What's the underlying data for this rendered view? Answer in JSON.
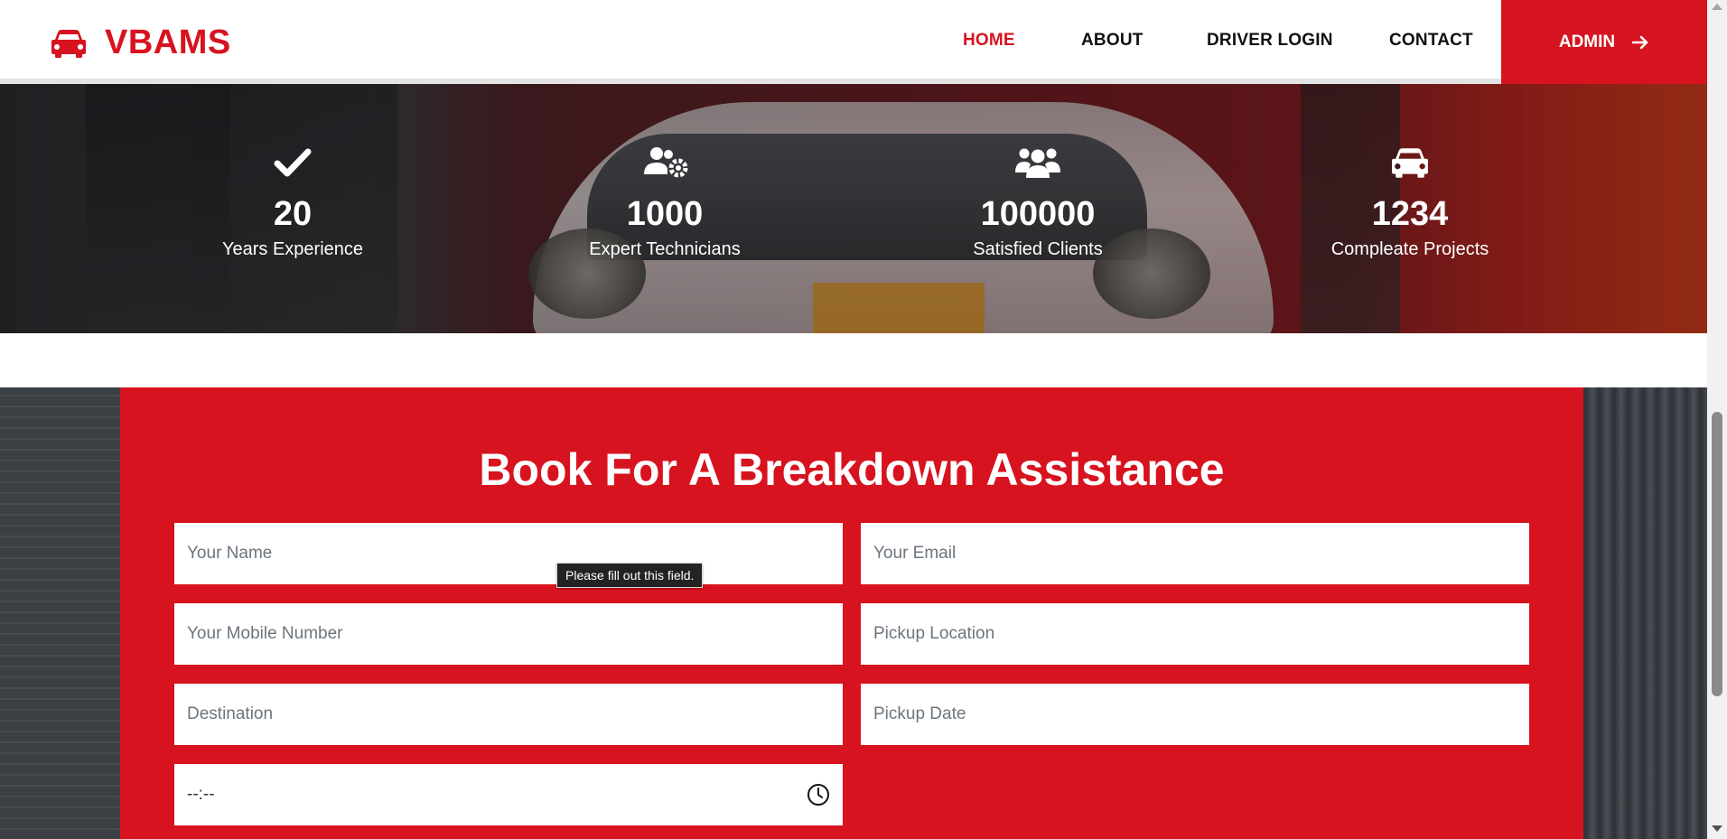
{
  "brand": {
    "name": "VBAMS",
    "icon": "car-icon",
    "color": "#d7131f"
  },
  "nav": {
    "items": [
      {
        "label": "HOME",
        "active": true
      },
      {
        "label": "ABOUT",
        "active": false
      },
      {
        "label": "DRIVER LOGIN",
        "active": false
      },
      {
        "label": "CONTACT",
        "active": false
      }
    ],
    "admin_label": "ADMIN",
    "admin_icon": "arrow-right-icon"
  },
  "stats": [
    {
      "icon": "check-icon",
      "number": "20",
      "label": "Years Experience"
    },
    {
      "icon": "users-gear-icon",
      "number": "1000",
      "label": "Expert Technicians"
    },
    {
      "icon": "users-icon",
      "number": "100000",
      "label": "Satisfied Clients"
    },
    {
      "icon": "car-icon",
      "number": "1234",
      "label": "Compleate Projects"
    }
  ],
  "booking": {
    "title": "Book For A Breakdown Assistance",
    "fields": {
      "name": "Your Name",
      "email": "Your Email",
      "mobile": "Your Mobile Number",
      "pickup_location": "Pickup Location",
      "destination": "Destination",
      "pickup_date": "Pickup Date",
      "time_value": "--:--"
    },
    "tooltip": "Please fill out this field.",
    "accent": "#d7131f"
  }
}
